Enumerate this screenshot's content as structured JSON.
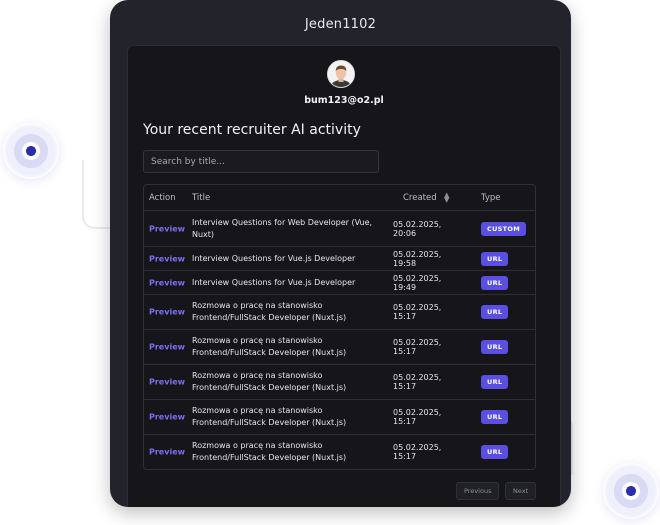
{
  "app": {
    "title": "Jeden1102"
  },
  "user": {
    "email": "bum123@o2.pl"
  },
  "page": {
    "heading": "Your recent recruiter AI activity"
  },
  "search": {
    "placeholder": "Search by title..."
  },
  "table": {
    "columns": [
      "Action",
      "Title",
      "Created",
      "Type"
    ],
    "rows": [
      {
        "action": "Preview",
        "title": "Interview Questions for Web Developer (Vue, Nuxt)",
        "created": "05.02.2025, 20:06",
        "type": "CUSTOM"
      },
      {
        "action": "Preview",
        "title": "Interview Questions for Vue.js Developer",
        "created": "05.02.2025, 19:58",
        "type": "URL"
      },
      {
        "action": "Preview",
        "title": "Interview Questions for Vue.js Developer",
        "created": "05.02.2025, 19:49",
        "type": "URL"
      },
      {
        "action": "Preview",
        "title": "Rozmowa o pracę na stanowisko Frontend/FullStack Developer (Nuxt.js)",
        "created": "05.02.2025, 15:17",
        "type": "URL"
      },
      {
        "action": "Preview",
        "title": "Rozmowa o pracę na stanowisko Frontend/FullStack Developer (Nuxt.js)",
        "created": "05.02.2025, 15:17",
        "type": "URL"
      },
      {
        "action": "Preview",
        "title": "Rozmowa o pracę na stanowisko Frontend/FullStack Developer (Nuxt.js)",
        "created": "05.02.2025, 15:17",
        "type": "URL"
      },
      {
        "action": "Preview",
        "title": "Rozmowa o pracę na stanowisko Frontend/FullStack Developer (Nuxt.js)",
        "created": "05.02.2025, 15:17",
        "type": "URL"
      },
      {
        "action": "Preview",
        "title": "Rozmowa o pracę na stanowisko Frontend/FullStack Developer (Nuxt.js)",
        "created": "05.02.2025, 15:17",
        "type": "URL"
      }
    ]
  },
  "pagination": {
    "previous": "Previous",
    "next": "Next"
  },
  "icons": {
    "sort": "sort-updown-icon",
    "avatar": "avatar"
  },
  "colors": {
    "accent": "#5a4fe0",
    "link": "#7a6ff0",
    "background": "#16161a"
  }
}
